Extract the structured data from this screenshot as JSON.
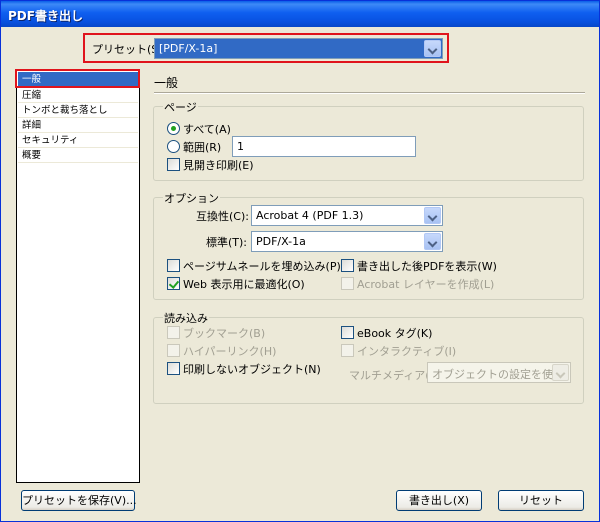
{
  "window": {
    "title": "PDF書き出し"
  },
  "preset": {
    "label": "プリセット(S):",
    "value": "[PDF/X-1a]"
  },
  "sidebar": {
    "items": [
      {
        "label": "一般"
      },
      {
        "label": "圧縮"
      },
      {
        "label": "トンボと裁ち落とし"
      },
      {
        "label": "詳細"
      },
      {
        "label": "セキュリティ"
      },
      {
        "label": "概要"
      }
    ]
  },
  "main": {
    "title": "一般",
    "pages": {
      "label": "ページ",
      "all_label": "すべて(A)",
      "range_label": "範囲(R)",
      "range_value": "1",
      "spreads_label": "見開き印刷(E)"
    },
    "options": {
      "label": "オプション",
      "compat_label": "互換性(C):",
      "compat_value": "Acrobat 4 (PDF 1.3)",
      "standard_label": "標準(T):",
      "standard_value": "PDF/X-1a",
      "embed_thumbs_label": "ページサムネールを埋め込み(P)",
      "view_after_label": "書き出した後PDFを表示(W)",
      "optimize_web_label": "Web 表示用に最適化(O)",
      "acrobat_layers_label": "Acrobat レイヤーを作成(L)"
    },
    "include": {
      "label": "読み込み",
      "bookmarks_label": "ブックマーク(B)",
      "ebook_tags_label": "eBook タグ(K)",
      "hyperlinks_label": "ハイパーリンク(H)",
      "interactive_label": "インタラクティブ(I)",
      "non_printing_label": "印刷しないオブジェクト(N)",
      "multimedia_label": "マルチメディア(M):",
      "multimedia_value": "オブジェクトの設定を使用"
    }
  },
  "buttons": {
    "save_preset": "プリセットを保存(V)...",
    "export": "書き出し(X)",
    "reset": "リセット"
  }
}
